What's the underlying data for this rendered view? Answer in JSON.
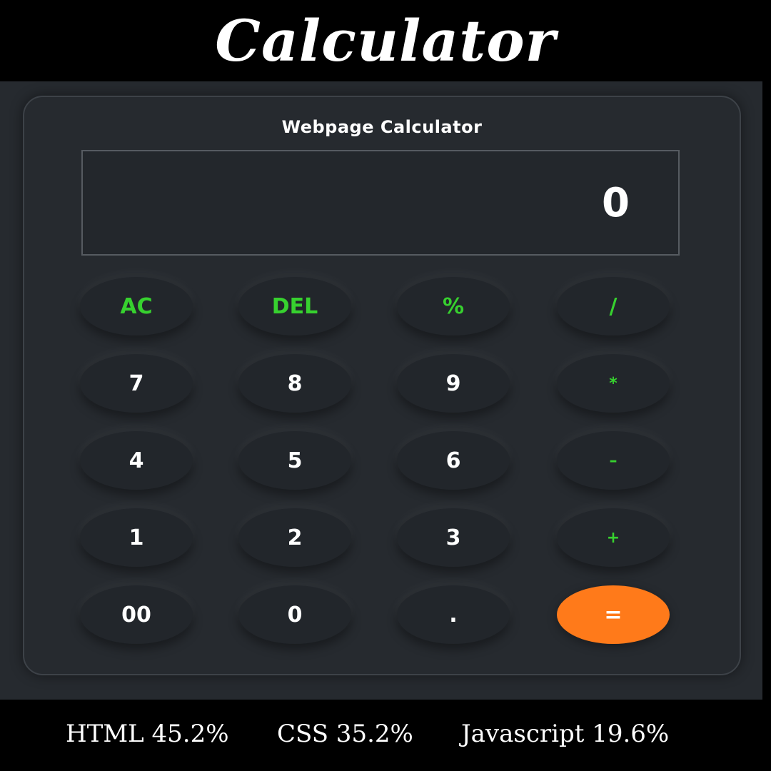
{
  "banner": {
    "title": "Calculator"
  },
  "calculator": {
    "heading": "Webpage Calculator",
    "display": "0",
    "keys": [
      {
        "label": "AC",
        "kind": "op"
      },
      {
        "label": "DEL",
        "kind": "op"
      },
      {
        "label": "%",
        "kind": "op"
      },
      {
        "label": "/",
        "kind": "op"
      },
      {
        "label": "7",
        "kind": "num"
      },
      {
        "label": "8",
        "kind": "num"
      },
      {
        "label": "9",
        "kind": "num"
      },
      {
        "label": "*",
        "kind": "op"
      },
      {
        "label": "4",
        "kind": "num"
      },
      {
        "label": "5",
        "kind": "num"
      },
      {
        "label": "6",
        "kind": "num"
      },
      {
        "label": "–",
        "kind": "op"
      },
      {
        "label": "1",
        "kind": "num"
      },
      {
        "label": "2",
        "kind": "num"
      },
      {
        "label": "3",
        "kind": "num"
      },
      {
        "label": "+",
        "kind": "op"
      },
      {
        "label": "00",
        "kind": "num"
      },
      {
        "label": "0",
        "kind": "num"
      },
      {
        "label": ".",
        "kind": "num"
      },
      {
        "label": "=",
        "kind": "equals"
      }
    ]
  },
  "stats": {
    "html": "HTML 45.2%",
    "css": "CSS 35.2%",
    "javascript": "Javascript 19.6%"
  },
  "colors": {
    "operator": "#37d12f",
    "equals": "#ff7a1a",
    "background": "#262a2f"
  }
}
